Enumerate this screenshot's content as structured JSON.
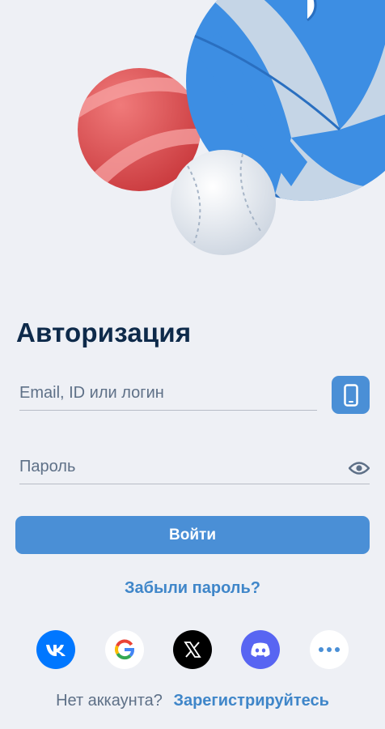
{
  "auth": {
    "title": "Авторизация",
    "login_placeholder": "Email, ID или логин",
    "password_placeholder": "Пароль",
    "submit_label": "Войти",
    "forgot_label": "Забыли пароль?",
    "no_account_label": "Нет аккаунта?",
    "register_label": "Зарегистрируйтесь"
  },
  "icons": {
    "phone": "phone-icon",
    "eye": "eye-icon",
    "social": [
      "vk-icon",
      "google-icon",
      "x-icon",
      "discord-icon",
      "more-icon"
    ]
  },
  "colors": {
    "background": "#eef0f5",
    "title": "#0e2a4a",
    "accent": "#4a8fd6",
    "link": "#3f86c9",
    "muted": "#5e7087",
    "vk": "#0077ff",
    "x": "#000000",
    "discord": "#5865f2"
  }
}
